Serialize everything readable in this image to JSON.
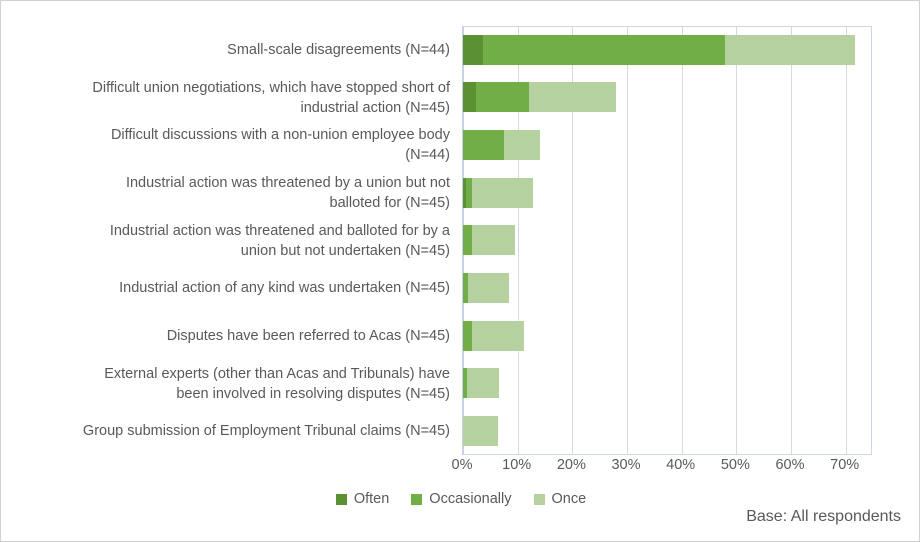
{
  "chart_data": {
    "type": "bar",
    "orientation": "horizontal",
    "stacked": true,
    "title": "",
    "xlabel": "",
    "ylabel": "",
    "xlim": [
      0,
      75
    ],
    "xticks": [
      "0%",
      "10%",
      "20%",
      "30%",
      "40%",
      "50%",
      "60%",
      "70%"
    ],
    "xtick_values": [
      0,
      10,
      20,
      30,
      40,
      50,
      60,
      70
    ],
    "grid": true,
    "legend_position": "bottom",
    "categories": [
      "Small-scale disagreements (N=44)",
      "Difficult union negotiations, which have stopped short of\nindustrial action (N=45)",
      "Difficult discussions with a non-union employee body\n(N=44)",
      "Industrial action was threatened by a union but not\nballoted for (N=45)",
      "Industrial action was threatened and balloted for by a\nunion but not undertaken (N=45)",
      "Industrial action of any kind was undertaken (N=45)",
      "Disputes have been referred to Acas (N=45)",
      "External experts (other than Acas and Tribunals) have\nbeen involved in resolving disputes (N=45)",
      "Group submission of Employment Tribunal claims (N=45)"
    ],
    "series": [
      {
        "name": "Often",
        "color": "#5B9033",
        "values": [
          3.7,
          2.4,
          0,
          0.5,
          0,
          0,
          0,
          0,
          0
        ]
      },
      {
        "name": "Occasionally",
        "color": "#72AE48",
        "values": [
          44.3,
          9.7,
          7.5,
          1.1,
          1.6,
          1.0,
          1.6,
          0.8,
          0
        ]
      },
      {
        "name": "Once",
        "color": "#B5D1A0",
        "values": [
          23.7,
          15.9,
          6.6,
          11.2,
          7.9,
          7.4,
          9.6,
          5.8,
          6.4
        ]
      }
    ]
  },
  "legend": {
    "items": [
      {
        "label": "Often",
        "color": "#5B9033"
      },
      {
        "label": "Occasionally",
        "color": "#72AE48"
      },
      {
        "label": "Once",
        "color": "#B5D1A0"
      }
    ]
  },
  "footer": {
    "base_note": "Base: All respondents"
  }
}
